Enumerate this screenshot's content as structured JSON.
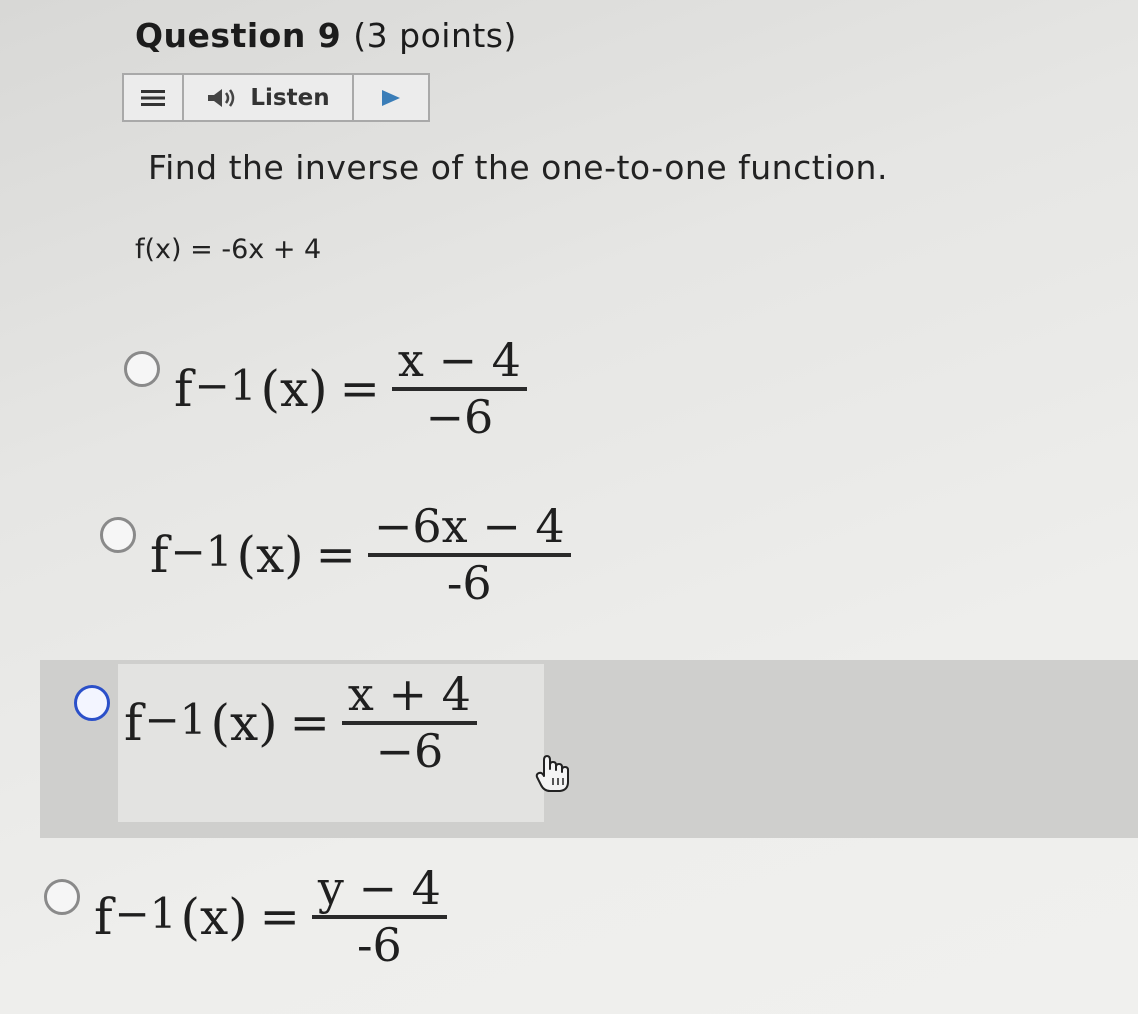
{
  "question": {
    "title_bold": "Question 9",
    "title_points": "(3 points)"
  },
  "listen_bar": {
    "menu_icon": "menu-icon",
    "speaker_icon": "speaker-icon",
    "listen_label": "Listen",
    "play_icon": "play-icon"
  },
  "prompt": "Find the inverse of the one-to-one function.",
  "function": "f(x) = -6x + 4",
  "options": [
    {
      "fn": "f",
      "sup": "−1",
      "arg": "(x)",
      "eq": "=",
      "numerator": "x − 4",
      "denominator": "−6"
    },
    {
      "fn": "f",
      "sup": "−1",
      "arg": "(x)",
      "eq": "=",
      "numerator": "−6x − 4",
      "denominator": "-6"
    },
    {
      "fn": "f",
      "sup": "−1",
      "arg": "(x)",
      "eq": "=",
      "numerator": "x + 4",
      "denominator": "−6"
    },
    {
      "fn": "f",
      "sup": "−1",
      "arg": "(x)",
      "eq": "=",
      "numerator": "y − 4",
      "denominator": "-6"
    }
  ],
  "colors": {
    "selected_radio": "#2b50c9",
    "hover_highlight": "#cfcfcd"
  }
}
